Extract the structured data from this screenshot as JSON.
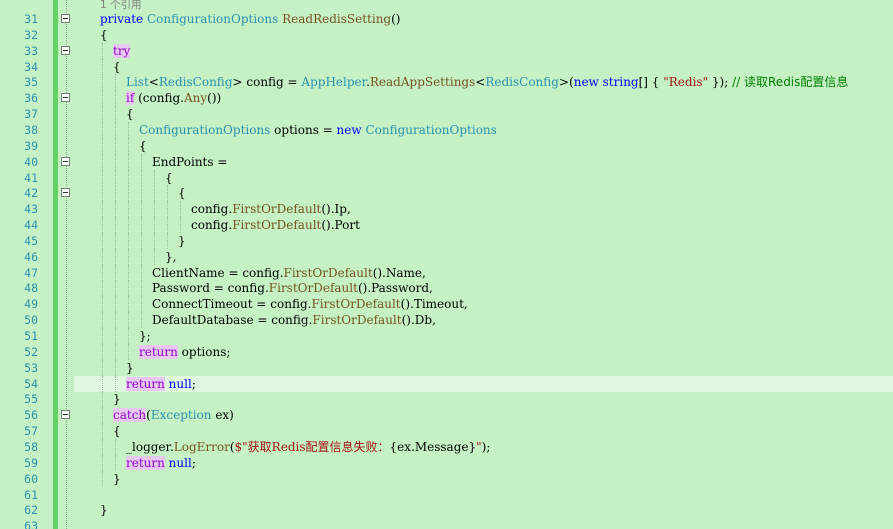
{
  "editor": {
    "code_lens": "1 个引用",
    "lines": [
      {
        "n": "31",
        "indent": 0,
        "fold": true,
        "tokens": [
          {
            "t": "private ",
            "c": "kw"
          },
          {
            "t": "ConfigurationOptions ",
            "c": "ty"
          },
          {
            "t": "ReadRedisSetting",
            "c": "mth"
          },
          {
            "t": "()",
            "c": ""
          }
        ]
      },
      {
        "n": "32",
        "indent": 0,
        "tokens": [
          {
            "t": "{",
            "c": ""
          }
        ]
      },
      {
        "n": "33",
        "indent": 1,
        "fold": true,
        "tokens": [
          {
            "t": "try",
            "c": "ctl"
          }
        ]
      },
      {
        "n": "34",
        "indent": 1,
        "tokens": [
          {
            "t": "{",
            "c": ""
          }
        ]
      },
      {
        "n": "35",
        "indent": 2,
        "tokens": [
          {
            "t": "List",
            "c": "ty"
          },
          {
            "t": "<",
            "c": ""
          },
          {
            "t": "RedisConfig",
            "c": "ty"
          },
          {
            "t": "> config = ",
            "c": ""
          },
          {
            "t": "AppHelper",
            "c": "ty"
          },
          {
            "t": ".",
            "c": ""
          },
          {
            "t": "ReadAppSettings",
            "c": "mth"
          },
          {
            "t": "<",
            "c": ""
          },
          {
            "t": "RedisConfig",
            "c": "ty"
          },
          {
            "t": ">(",
            "c": ""
          },
          {
            "t": "new ",
            "c": "kw"
          },
          {
            "t": "string",
            "c": "kw"
          },
          {
            "t": "[] { ",
            "c": ""
          },
          {
            "t": "\"Redis\"",
            "c": "str"
          },
          {
            "t": " }); ",
            "c": ""
          },
          {
            "t": "// 读取Redis配置信息",
            "c": "cm"
          }
        ]
      },
      {
        "n": "36",
        "indent": 2,
        "fold": true,
        "tokens": [
          {
            "t": "if",
            "c": "ctl"
          },
          {
            "t": " (config.",
            "c": ""
          },
          {
            "t": "Any",
            "c": "mth"
          },
          {
            "t": "())",
            "c": ""
          }
        ]
      },
      {
        "n": "37",
        "indent": 2,
        "tokens": [
          {
            "t": "{",
            "c": ""
          }
        ]
      },
      {
        "n": "38",
        "indent": 3,
        "tokens": [
          {
            "t": "ConfigurationOptions ",
            "c": "ty"
          },
          {
            "t": "options = ",
            "c": ""
          },
          {
            "t": "new ",
            "c": "kw"
          },
          {
            "t": "ConfigurationOptions",
            "c": "ty"
          }
        ]
      },
      {
        "n": "39",
        "indent": 3,
        "tokens": [
          {
            "t": "{",
            "c": ""
          }
        ]
      },
      {
        "n": "40",
        "indent": 4,
        "fold": true,
        "tokens": [
          {
            "t": "EndPoints =",
            "c": ""
          }
        ]
      },
      {
        "n": "41",
        "indent": 5,
        "tokens": [
          {
            "t": "{",
            "c": ""
          }
        ]
      },
      {
        "n": "42",
        "indent": 6,
        "fold": true,
        "tokens": [
          {
            "t": "{",
            "c": ""
          }
        ]
      },
      {
        "n": "43",
        "indent": 7,
        "tokens": [
          {
            "t": "config.",
            "c": ""
          },
          {
            "t": "FirstOrDefault",
            "c": "mth"
          },
          {
            "t": "().Ip,",
            "c": ""
          }
        ]
      },
      {
        "n": "44",
        "indent": 7,
        "tokens": [
          {
            "t": "config.",
            "c": ""
          },
          {
            "t": "FirstOrDefault",
            "c": "mth"
          },
          {
            "t": "().Port",
            "c": ""
          }
        ]
      },
      {
        "n": "45",
        "indent": 6,
        "tokens": [
          {
            "t": "}",
            "c": ""
          }
        ]
      },
      {
        "n": "46",
        "indent": 5,
        "tokens": [
          {
            "t": "},",
            "c": ""
          }
        ]
      },
      {
        "n": "47",
        "indent": 4,
        "tokens": [
          {
            "t": "ClientName = config.",
            "c": ""
          },
          {
            "t": "FirstOrDefault",
            "c": "mth"
          },
          {
            "t": "().Name,",
            "c": ""
          }
        ]
      },
      {
        "n": "48",
        "indent": 4,
        "tokens": [
          {
            "t": "Password = config.",
            "c": ""
          },
          {
            "t": "FirstOrDefault",
            "c": "mth"
          },
          {
            "t": "().Password,",
            "c": ""
          }
        ]
      },
      {
        "n": "49",
        "indent": 4,
        "tokens": [
          {
            "t": "ConnectTimeout = config.",
            "c": ""
          },
          {
            "t": "FirstOrDefault",
            "c": "mth"
          },
          {
            "t": "().Timeout,",
            "c": ""
          }
        ]
      },
      {
        "n": "50",
        "indent": 4,
        "tokens": [
          {
            "t": "DefaultDatabase = config.",
            "c": ""
          },
          {
            "t": "FirstOrDefault",
            "c": "mth"
          },
          {
            "t": "().Db,",
            "c": ""
          }
        ]
      },
      {
        "n": "51",
        "indent": 3,
        "tokens": [
          {
            "t": "};",
            "c": ""
          }
        ]
      },
      {
        "n": "52",
        "indent": 3,
        "tokens": [
          {
            "t": "return",
            "c": "ctl"
          },
          {
            "t": " options;",
            "c": ""
          }
        ]
      },
      {
        "n": "53",
        "indent": 2,
        "tokens": [
          {
            "t": "}",
            "c": ""
          }
        ]
      },
      {
        "n": "54",
        "indent": 2,
        "highlight": true,
        "tokens": [
          {
            "t": "return",
            "c": "ctl"
          },
          {
            "t": " null",
            "c": "kw"
          },
          {
            "t": ";",
            "c": ""
          }
        ]
      },
      {
        "n": "55",
        "indent": 1,
        "tokens": [
          {
            "t": "}",
            "c": ""
          }
        ]
      },
      {
        "n": "56",
        "indent": 1,
        "fold": true,
        "tokens": [
          {
            "t": "catch",
            "c": "ctl"
          },
          {
            "t": "(",
            "c": ""
          },
          {
            "t": "Exception",
            "c": "ty"
          },
          {
            "t": " ex)",
            "c": ""
          }
        ]
      },
      {
        "n": "57",
        "indent": 1,
        "tokens": [
          {
            "t": "{",
            "c": ""
          }
        ]
      },
      {
        "n": "58",
        "indent": 2,
        "tokens": [
          {
            "t": "_logger.",
            "c": ""
          },
          {
            "t": "LogError",
            "c": "mth"
          },
          {
            "t": "(",
            "c": ""
          },
          {
            "t": "$\"获取Redis配置信息失败：",
            "c": "str"
          },
          {
            "t": "{ex.Message}",
            "c": ""
          },
          {
            "t": "\"",
            "c": "str"
          },
          {
            "t": ");",
            "c": ""
          }
        ]
      },
      {
        "n": "59",
        "indent": 2,
        "tokens": [
          {
            "t": "return",
            "c": "ctl"
          },
          {
            "t": " null",
            "c": "kw"
          },
          {
            "t": ";",
            "c": ""
          }
        ]
      },
      {
        "n": "60",
        "indent": 1,
        "tokens": [
          {
            "t": "}",
            "c": ""
          }
        ]
      },
      {
        "n": "61",
        "indent": 0,
        "tokens": []
      },
      {
        "n": "62",
        "indent": 0,
        "tokens": [
          {
            "t": "}",
            "c": ""
          }
        ]
      },
      {
        "n": "63",
        "indent": 0,
        "tokens": []
      }
    ]
  },
  "colors": {
    "background": "#c5f1c5",
    "line_number": "#2b91af",
    "keyword": "#0000ff",
    "type": "#2b91af",
    "string": "#a31515",
    "comment": "#008000",
    "change_bar": "#64d264"
  }
}
